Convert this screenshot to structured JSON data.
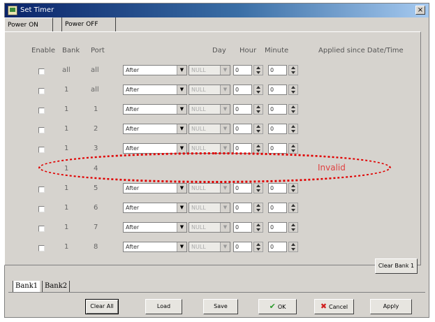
{
  "window": {
    "title": "Set Timer",
    "close_glyph": "×"
  },
  "tabs": [
    {
      "label": "Power ON"
    },
    {
      "label": "Power OFF"
    }
  ],
  "headers": {
    "enable": "Enable",
    "bank": "Bank",
    "port": "Port",
    "day": "Day",
    "hour": "Hour",
    "minute": "Minute",
    "applied": "Applied since Date/Time"
  },
  "rows": [
    {
      "bank": "all",
      "port": "all",
      "mode": "After",
      "day": "NULL",
      "hour": "0",
      "minute": "0",
      "invalid": false
    },
    {
      "bank": "1",
      "port": "all",
      "mode": "After",
      "day": "NULL",
      "hour": "0",
      "minute": "0",
      "invalid": false
    },
    {
      "bank": "1",
      "port": "1",
      "mode": "After",
      "day": "NULL",
      "hour": "0",
      "minute": "0",
      "invalid": false
    },
    {
      "bank": "1",
      "port": "2",
      "mode": "After",
      "day": "NULL",
      "hour": "0",
      "minute": "0",
      "invalid": false
    },
    {
      "bank": "1",
      "port": "3",
      "mode": "After",
      "day": "NULL",
      "hour": "0",
      "minute": "0",
      "invalid": false
    },
    {
      "bank": "1",
      "port": "4",
      "status": "Invalid",
      "invalid": true
    },
    {
      "bank": "1",
      "port": "5",
      "mode": "After",
      "day": "NULL",
      "hour": "0",
      "minute": "0",
      "invalid": false
    },
    {
      "bank": "1",
      "port": "6",
      "mode": "After",
      "day": "NULL",
      "hour": "0",
      "minute": "0",
      "invalid": false
    },
    {
      "bank": "1",
      "port": "7",
      "mode": "After",
      "day": "NULL",
      "hour": "0",
      "minute": "0",
      "invalid": false
    },
    {
      "bank": "1",
      "port": "8",
      "mode": "After",
      "day": "NULL",
      "hour": "0",
      "minute": "0",
      "invalid": false
    }
  ],
  "clear_bank_label": "Clear Bank 1",
  "bank_tabs": [
    {
      "label": "Bank1"
    },
    {
      "label": "Bank2"
    }
  ],
  "buttons": {
    "clear_all": "Clear All",
    "load": "Load",
    "save": "Save",
    "ok": "OK",
    "cancel": "Cancel",
    "apply": "Apply"
  },
  "icons": {
    "ok": "check-icon",
    "cancel": "x-icon",
    "dropdown": "chevron-down-icon",
    "spinner": "spinner-icon"
  },
  "colors": {
    "invalid_highlight": "#e00000",
    "titlebar": "#0a246a"
  }
}
